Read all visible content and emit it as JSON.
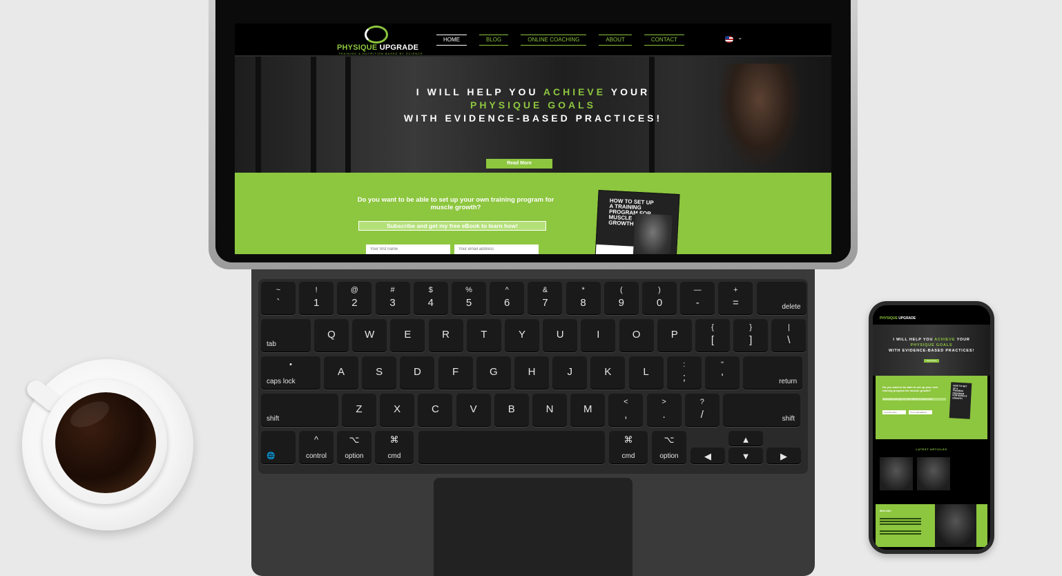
{
  "site": {
    "logo_brand_a": "PHYSIQUE",
    "logo_brand_b": "UPGRADE",
    "logo_tagline": "TRAINING & NUTRITION BASED BY SCIENCE",
    "menu": [
      "HOME",
      "BLOG",
      "ONLINE COACHING",
      "ABOUT",
      "CONTACT"
    ],
    "active_menu": "HOME",
    "language_flag": "us-flag-icon",
    "hero": {
      "line1_a": "I WILL HELP YOU ",
      "line1_b": "ACHIEVE",
      "line1_c": " YOUR",
      "line2": "PHYSIQUE GOALS",
      "line3": "WITH EVIDENCE-BASED PRACTICES!",
      "button": "Read More"
    },
    "optin": {
      "question": "Do you want to be able to set up your own training program for muscle growth?",
      "subscribe": "Subscribe and get my free eBook to learn how!",
      "first_name_placeholder": "Your first name",
      "email_placeholder": "Your email address",
      "ebook_title": "HOW TO SET UP A TRAINING PROGRAM FOR MUSCLE GROWTH"
    },
    "latest_articles": "LATEST ARTICLES",
    "who_am_i": "WHO AM I"
  },
  "keyboard": {
    "row1": [
      [
        "~",
        "`"
      ],
      [
        "!",
        "1"
      ],
      [
        "@",
        "2"
      ],
      [
        "#",
        "3"
      ],
      [
        "$",
        "4"
      ],
      [
        "%",
        "5"
      ],
      [
        "^",
        "6"
      ],
      [
        "&",
        "7"
      ],
      [
        "*",
        "8"
      ],
      [
        "(",
        "9"
      ],
      [
        ")",
        "0"
      ],
      [
        "—",
        "-"
      ],
      [
        "+",
        "="
      ]
    ],
    "delete": "delete",
    "tab": "tab",
    "row2": [
      "Q",
      "W",
      "E",
      "R",
      "T",
      "Y",
      "U",
      "I",
      "O",
      "P"
    ],
    "row2_pairs": [
      [
        "{",
        "["
      ],
      [
        "}",
        "]"
      ],
      [
        "|",
        "\\"
      ]
    ],
    "caps": "caps lock",
    "row3": [
      "A",
      "S",
      "D",
      "F",
      "G",
      "H",
      "J",
      "K",
      "L"
    ],
    "row3_pairs": [
      [
        ":",
        ";"
      ],
      [
        "\"",
        "'"
      ]
    ],
    "return": "return",
    "shift": "shift",
    "row4": [
      "Z",
      "X",
      "C",
      "V",
      "B",
      "N",
      "M"
    ],
    "row4_pairs": [
      [
        "<",
        ","
      ],
      [
        ">",
        "."
      ],
      [
        "?",
        "/"
      ]
    ],
    "globe_icon": "globe-icon",
    "control": "control",
    "option": "option",
    "cmd": "cmd",
    "control_glyph": "^",
    "option_glyph": "⌥",
    "cmd_glyph": "⌘",
    "arrows": [
      "◀",
      "▲",
      "▼",
      "▶"
    ]
  },
  "colors": {
    "brand_green": "#8dc63f",
    "background": "#e9e9e9"
  }
}
